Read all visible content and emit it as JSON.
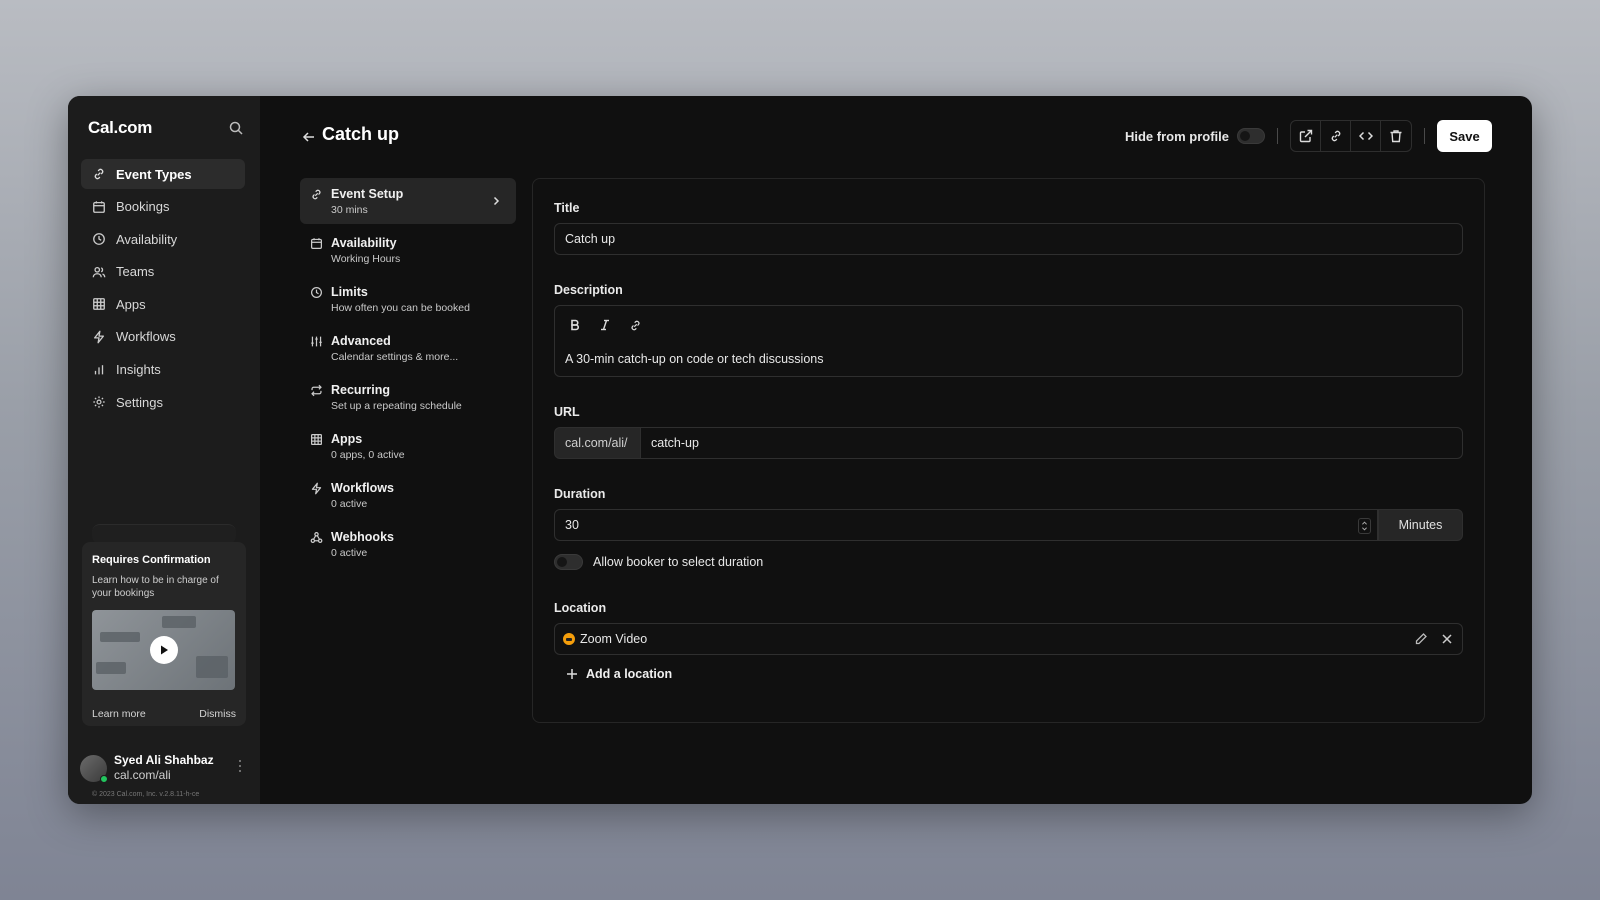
{
  "sidebar": {
    "logo": "Cal.com",
    "items": [
      {
        "label": "Event Types",
        "icon": "link-icon"
      },
      {
        "label": "Bookings",
        "icon": "calendar-icon"
      },
      {
        "label": "Availability",
        "icon": "clock-icon"
      },
      {
        "label": "Teams",
        "icon": "users-icon"
      },
      {
        "label": "Apps",
        "icon": "grid-icon"
      },
      {
        "label": "Workflows",
        "icon": "zap-icon"
      },
      {
        "label": "Insights",
        "icon": "bar-chart-icon"
      },
      {
        "label": "Settings",
        "icon": "gear-icon"
      }
    ],
    "promo": {
      "title": "Requires Confirmation",
      "text": "Learn how to be in charge of your bookings",
      "learn_more": "Learn more",
      "dismiss": "Dismiss"
    },
    "user": {
      "name": "Syed Ali Shahbaz",
      "handle": "cal.com/ali"
    },
    "copyright": "© 2023 Cal.com, Inc. v.2.8.11-h-ce"
  },
  "header": {
    "title": "Catch up",
    "hide_label": "Hide from profile",
    "save_label": "Save"
  },
  "steps": [
    {
      "title": "Event Setup",
      "sub": "30 mins"
    },
    {
      "title": "Availability",
      "sub": "Working Hours"
    },
    {
      "title": "Limits",
      "sub": "How often you can be booked"
    },
    {
      "title": "Advanced",
      "sub": "Calendar settings & more..."
    },
    {
      "title": "Recurring",
      "sub": "Set up a repeating schedule"
    },
    {
      "title": "Apps",
      "sub": "0 apps, 0 active"
    },
    {
      "title": "Workflows",
      "sub": "0 active"
    },
    {
      "title": "Webhooks",
      "sub": "0 active"
    }
  ],
  "form": {
    "title_label": "Title",
    "title_value": "Catch up",
    "description_label": "Description",
    "description_value": "A 30-min catch-up on code or tech discussions",
    "url_label": "URL",
    "url_prefix": "cal.com/ali/",
    "url_value": "catch-up",
    "duration_label": "Duration",
    "duration_value": "30",
    "duration_unit": "Minutes",
    "booker_label": "Allow booker to select duration",
    "location_label": "Location",
    "location_value": "Zoom Video",
    "add_location": "Add a location"
  },
  "colors": {
    "accent": "#ffffff",
    "background": "#101010",
    "zoom": "#f59e0b",
    "online": "#22c55e"
  }
}
